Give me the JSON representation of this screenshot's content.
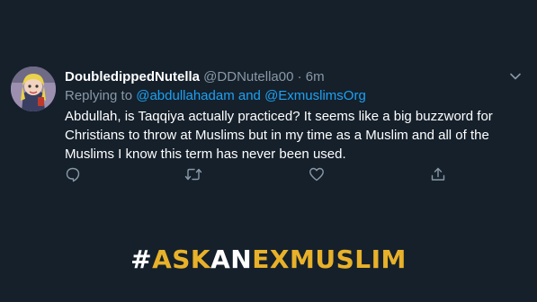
{
  "tweet": {
    "display_name": "DoubledippedNutella",
    "handle": "@DDNutella00",
    "separator": "·",
    "time": "6m",
    "replying_prefix": "Replying to",
    "reply_mention_1": "@abdullahadam",
    "reply_and": "and",
    "reply_mention_2": "@ExmuslimsOrg",
    "text": "Abdullah, is Taqqiya actually practiced? It seems like a big buzzword for Christians to throw at Muslims but in my time as a Muslim and all of the Muslims I know this term has never been used."
  },
  "actions": {
    "reply_icon": "reply-icon",
    "retweet_icon": "retweet-icon",
    "like_icon": "heart-icon",
    "share_icon": "share-icon"
  },
  "hashtag": {
    "hash": "#",
    "part1": "ASK",
    "part2": "AN",
    "part3": "EXMUSLIM"
  },
  "colors": {
    "background": "#15202b",
    "secondary_text": "#8899a6",
    "link": "#1da1f2",
    "hashtag_gold": "#e8b12a"
  }
}
